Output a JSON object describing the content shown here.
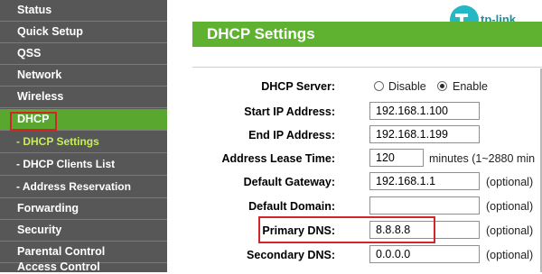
{
  "sidebar": {
    "items": [
      {
        "label": "Status"
      },
      {
        "label": "Quick Setup"
      },
      {
        "label": "QSS"
      },
      {
        "label": "Network"
      },
      {
        "label": "Wireless"
      },
      {
        "label": "DHCP"
      },
      {
        "label": "- DHCP Settings"
      },
      {
        "label": "- DHCP Clients List"
      },
      {
        "label": "- Address Reservation"
      },
      {
        "label": "Forwarding"
      },
      {
        "label": "Security"
      },
      {
        "label": "Parental Control"
      },
      {
        "label": "Access Control"
      }
    ],
    "active_item": "DHCP",
    "active_sub_item": "- DHCP Settings"
  },
  "header": {
    "title": "DHCP Settings",
    "brand": "tp-link"
  },
  "form": {
    "dhcp_server": {
      "label": "DHCP Server:",
      "options": [
        "Disable",
        "Enable"
      ],
      "selected": "Enable"
    },
    "start_ip": {
      "label": "Start IP Address:",
      "value": "192.168.1.100"
    },
    "end_ip": {
      "label": "End IP Address:",
      "value": "192.168.1.199"
    },
    "lease_time": {
      "label": "Address Lease Time:",
      "value": "120",
      "suffix": "minutes (1~2880 min"
    },
    "gateway": {
      "label": "Default Gateway:",
      "value": "192.168.1.1",
      "suffix": "(optional)"
    },
    "domain": {
      "label": "Default Domain:",
      "value": "",
      "suffix": "(optional)"
    },
    "primary_dns": {
      "label": "Primary DNS:",
      "value": "8.8.8.8",
      "suffix": "(optional)"
    },
    "secondary_dns": {
      "label": "Secondary DNS:",
      "value": "0.0.0.0",
      "suffix": "(optional)"
    }
  },
  "colors": {
    "sidebar_bg": "#575757",
    "active_green": "#5aa730",
    "title_green": "#5fb130",
    "highlight_red": "#d0262b",
    "logo_teal": "#25b7c3"
  }
}
